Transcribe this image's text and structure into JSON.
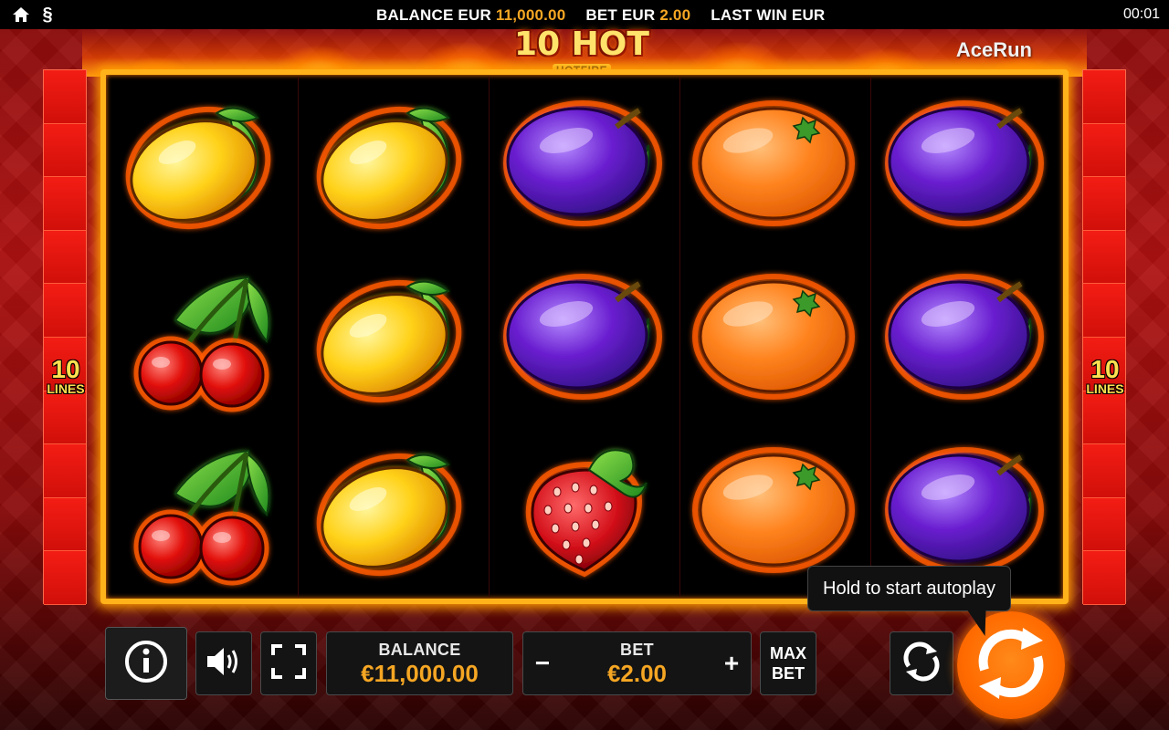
{
  "topbar": {
    "balance_label": "BALANCE EUR",
    "balance_value": "11,000.00",
    "bet_label": "BET EUR",
    "bet_value": "2.00",
    "last_win_label": "LAST WIN EUR",
    "time": "00:01",
    "paragraph_symbol": "§"
  },
  "header": {
    "logo_title": "10 HOT",
    "logo_subtitle": "HOTFIRE",
    "brand": "AceRun"
  },
  "lines": {
    "count": "10",
    "label": "LINES"
  },
  "reels": [
    [
      "lemon",
      "cherry",
      "cherry"
    ],
    [
      "lemon",
      "lemon",
      "lemon"
    ],
    [
      "plum",
      "plum",
      "strawberry"
    ],
    [
      "orange",
      "orange",
      "orange"
    ],
    [
      "plum",
      "plum",
      "plum"
    ]
  ],
  "controls": {
    "balance_label": "BALANCE",
    "balance_value": "€11,000.00",
    "bet_label": "BET",
    "bet_value": "€2.00",
    "bet_minus": "−",
    "bet_plus": "+",
    "maxbet_line1": "MAX",
    "maxbet_line2": "BET"
  },
  "tooltip": {
    "text": "Hold to start autoplay"
  },
  "colors": {
    "accent_orange": "#f5a623",
    "spin_orange": "#ff6a00",
    "frame_gold": "#ffb21a",
    "side_red": "#e3150f"
  },
  "icons": {
    "home": "home-icon",
    "paragraph": "paragraph-icon",
    "info": "info-icon",
    "sound": "speaker-icon",
    "fullscreen": "fullscreen-icon",
    "autoplay": "autoplay-icon",
    "spin": "spin-icon"
  }
}
